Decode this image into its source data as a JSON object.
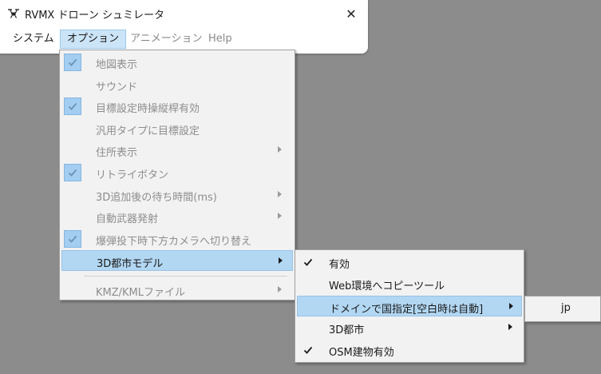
{
  "window": {
    "title": "RVMX ドローン シュミレータ",
    "close_glyph": "✕"
  },
  "menubar": [
    {
      "label": "システム",
      "state": "normal"
    },
    {
      "label": "オプション",
      "state": "active"
    },
    {
      "label": "アニメーション",
      "state": "disabled"
    },
    {
      "label": "Help",
      "state": "disabled"
    }
  ],
  "options_menu": [
    {
      "label": "地図表示",
      "checked": true,
      "disabled": true
    },
    {
      "label": "サウンド",
      "checked": false,
      "disabled": true
    },
    {
      "label": "目標設定時操縦桿有効",
      "checked": true,
      "disabled": true
    },
    {
      "label": "汎用タイプに目標設定",
      "checked": false,
      "disabled": true
    },
    {
      "label": "住所表示",
      "checked": false,
      "disabled": true,
      "submenu": true
    },
    {
      "label": "リトライボタン",
      "checked": true,
      "disabled": true
    },
    {
      "label": "3D追加後の待ち時間(ms)",
      "checked": false,
      "disabled": true,
      "submenu": true
    },
    {
      "label": "自動武器発射",
      "checked": false,
      "disabled": true,
      "submenu": true
    },
    {
      "label": "爆弾投下時下方カメラへ切り替え",
      "checked": true,
      "disabled": true
    },
    {
      "label": "3D都市モデル",
      "checked": false,
      "disabled": false,
      "submenu": true,
      "highlight": true
    },
    {
      "separator": true
    },
    {
      "label": "KMZ/KMLファイル",
      "checked": false,
      "disabled": true,
      "submenu": true
    }
  ],
  "city_model_menu": [
    {
      "label": "有効",
      "checked": true
    },
    {
      "label": "Web環境へコピーツール",
      "checked": false
    },
    {
      "label": "ドメインで国指定[空白時は自動]",
      "checked": false,
      "submenu": true,
      "highlight": true
    },
    {
      "label": "3D都市",
      "checked": false,
      "submenu": true
    },
    {
      "label": "OSM建物有効",
      "checked": true
    }
  ],
  "domain_menu": [
    {
      "label": "jp"
    }
  ],
  "colors": {
    "highlight": "#b2d7f3",
    "check_bg": "#a3cdf1",
    "menu_bg": "#f2f2f2",
    "desktop": "#8c8c8c"
  }
}
